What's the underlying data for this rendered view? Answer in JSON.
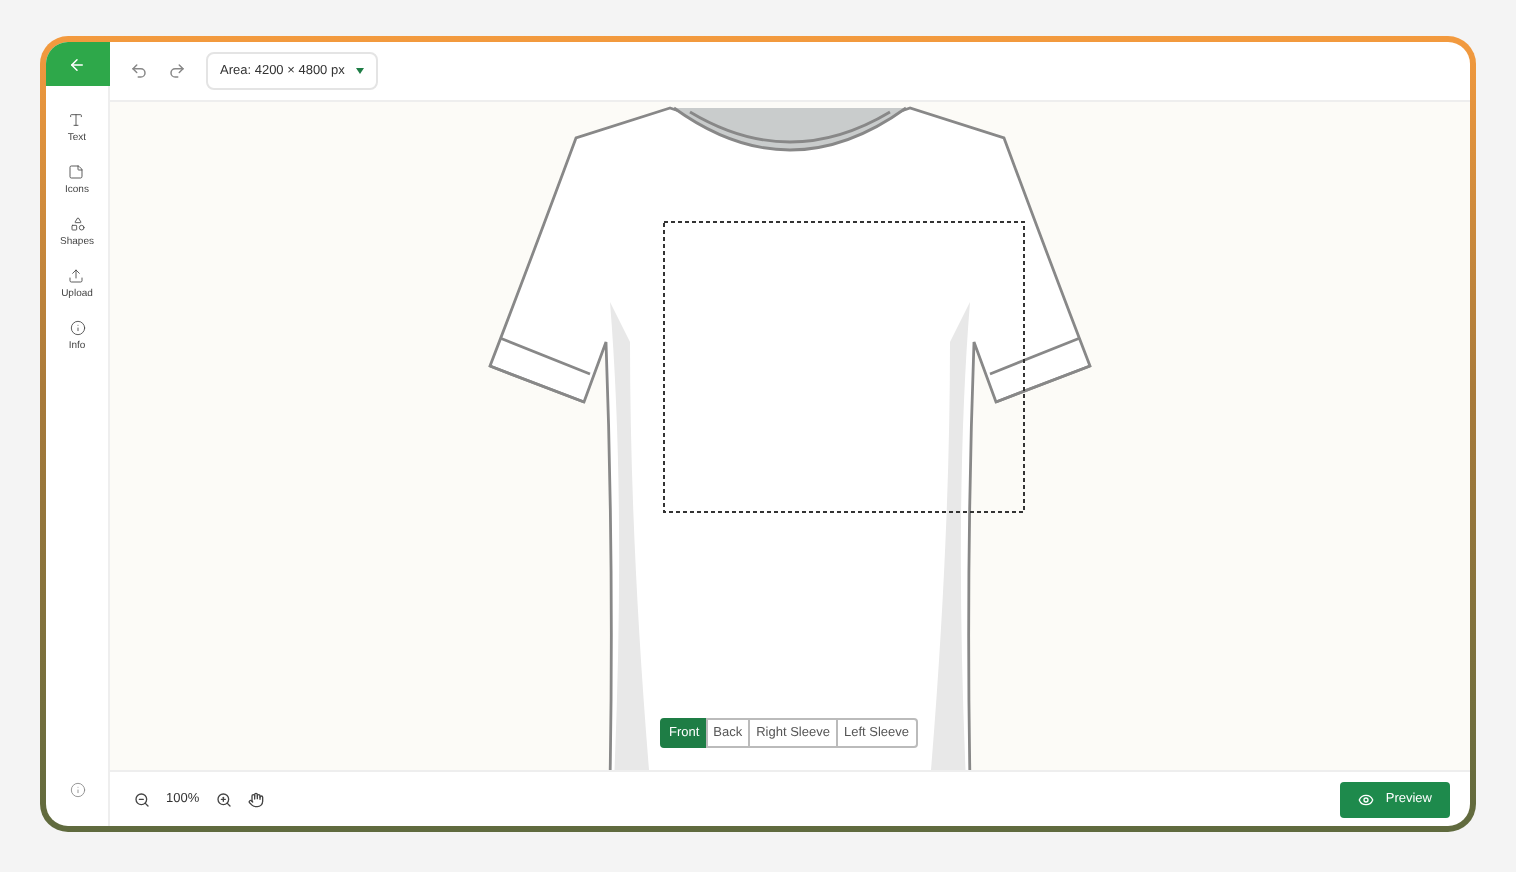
{
  "toolbar": {
    "area_select": "Area: 4200 × 4800 px"
  },
  "sidebar": {
    "items": [
      {
        "label": "Text"
      },
      {
        "label": "Icons"
      },
      {
        "label": "Shapes"
      },
      {
        "label": "Upload"
      },
      {
        "label": "Info"
      }
    ]
  },
  "views": [
    {
      "label": "Front",
      "selected": true
    },
    {
      "label": "Back",
      "selected": false
    },
    {
      "label": "Right Sleeve",
      "selected": false
    },
    {
      "label": "Left Sleeve",
      "selected": false
    }
  ],
  "zoom": {
    "value": "100%"
  },
  "preview_button": "Preview"
}
